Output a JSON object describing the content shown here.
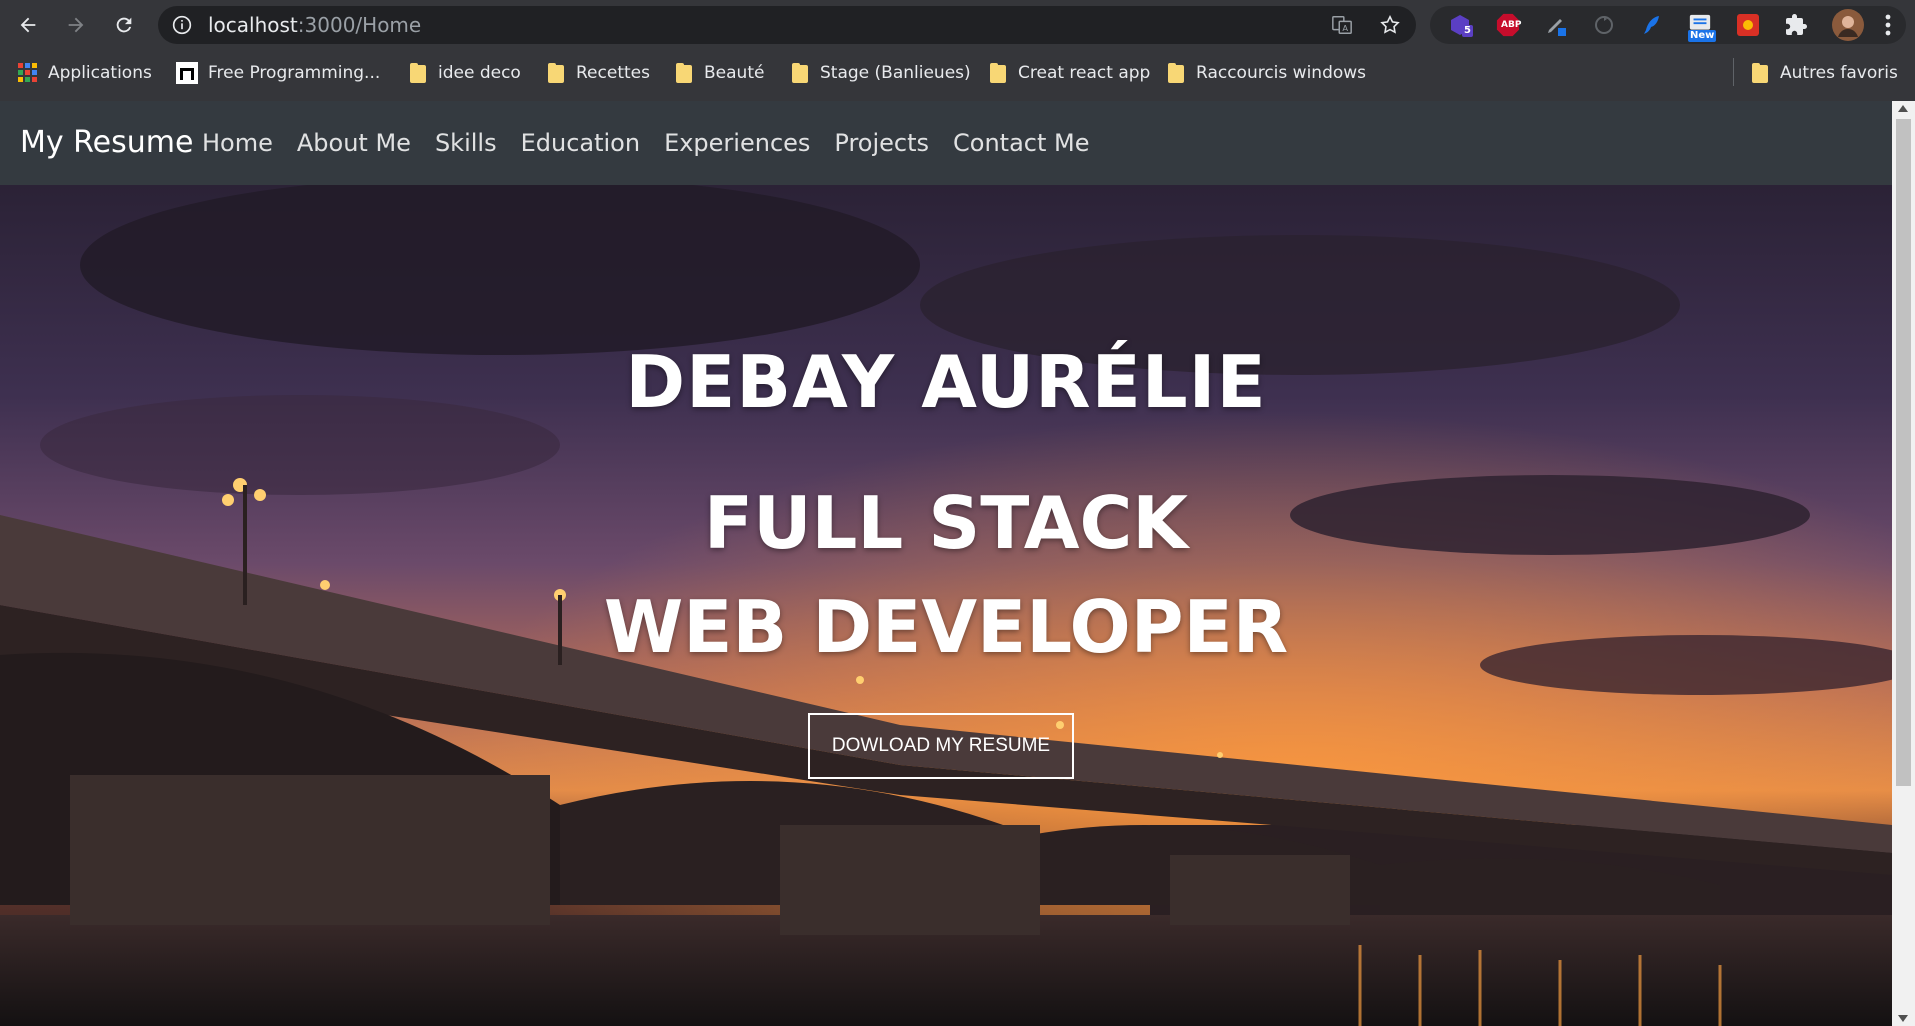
{
  "browser": {
    "url_host": "localhost",
    "url_rest": ":3000/Home",
    "extension_badges": {
      "ext1": "5",
      "abp": "ABP",
      "new": "New"
    },
    "bookmarks": [
      {
        "label": "Applications",
        "icon": "apps-grid-icon"
      },
      {
        "label": "Free Programming...",
        "icon": "site-icon"
      },
      {
        "label": "idee deco",
        "icon": "folder-icon"
      },
      {
        "label": "Recettes",
        "icon": "folder-icon"
      },
      {
        "label": "Beauté",
        "icon": "folder-icon"
      },
      {
        "label": "Stage (Banlieues)",
        "icon": "folder-icon"
      },
      {
        "label": "Creat react app",
        "icon": "folder-icon"
      },
      {
        "label": "Raccourcis windows",
        "icon": "folder-icon"
      }
    ],
    "other_bookmarks": "Autres favoris"
  },
  "navbar": {
    "brand": "My Resume",
    "links": [
      "Home",
      "About Me",
      "Skills",
      "Education",
      "Experiences",
      "Projects",
      "Contact Me"
    ]
  },
  "hero": {
    "name": "DEBAY AURÉLIE",
    "role_line1": "FULL STACK",
    "role_line2": "WEB DEVELOPER",
    "cta_label": "DOWLOAD MY RESUME"
  },
  "colors": {
    "navbar_bg": "#343a40",
    "chrome_bg": "#35363a",
    "omnibox_bg": "#202124",
    "folder": "#f8d775"
  }
}
